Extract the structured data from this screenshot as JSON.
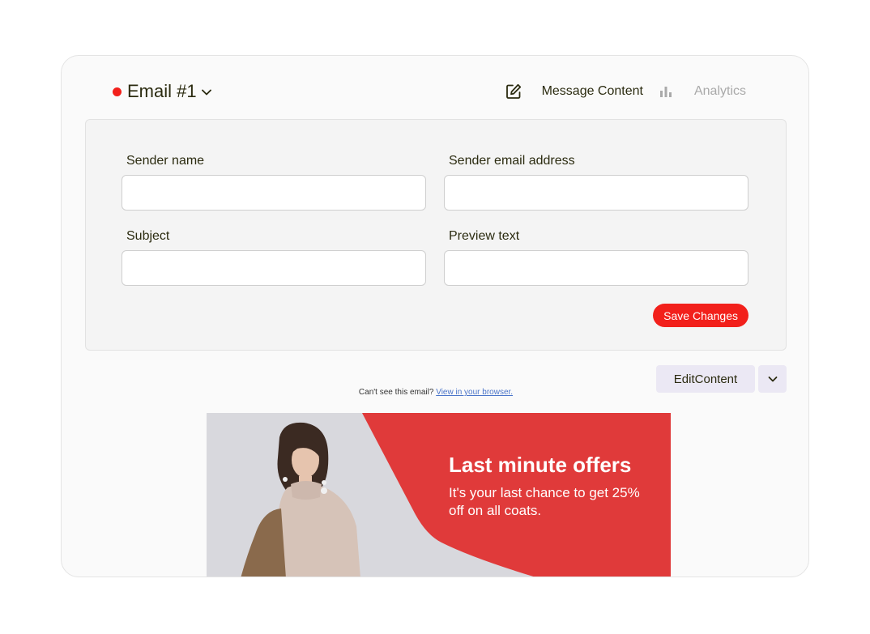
{
  "header": {
    "title": "Email #1",
    "status_color": "#f2201b",
    "tabs": [
      {
        "label": "Message Content",
        "icon": "edit-icon",
        "active": true
      },
      {
        "label": "Analytics",
        "icon": "bar-chart-icon",
        "active": false
      }
    ]
  },
  "form": {
    "sender_name": {
      "label": "Sender name",
      "value": "",
      "placeholder": ""
    },
    "sender_email": {
      "label": "Sender email address",
      "value": "",
      "placeholder": ""
    },
    "subject": {
      "label": "Subject",
      "value": "",
      "placeholder": ""
    },
    "preview_text": {
      "label": "Preview text",
      "value": "",
      "placeholder": ""
    },
    "save_label": "Save Changes"
  },
  "toolbar": {
    "edit_content_label": "EditContent",
    "dropdown_icon": "chevron-down-icon"
  },
  "email_preview": {
    "browser_note": "Can't see this email?",
    "browser_link": "View in your browser.",
    "banner": {
      "headline": "Last minute offers",
      "subtext": "It's your last chance to get 25% off on all coats.",
      "accent_color": "#e03a3a",
      "image": "woman-in-coat-photo"
    }
  },
  "colors": {
    "accent": "#f2201b",
    "secondary_button": "#ebe8f4",
    "panel_bg": "#f4f4f4"
  }
}
